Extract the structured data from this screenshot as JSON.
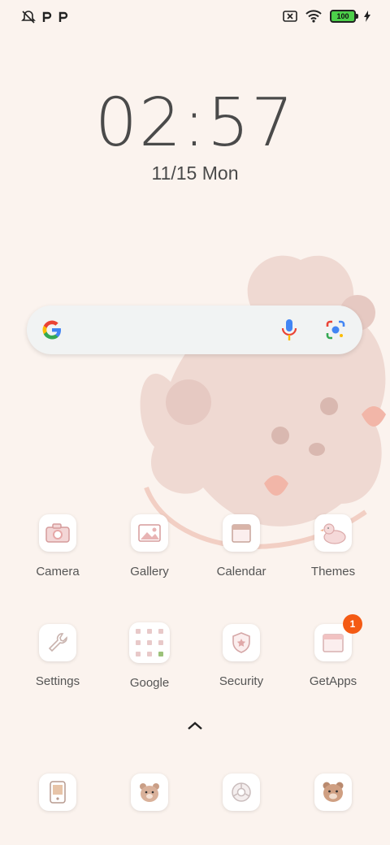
{
  "status_bar": {
    "left_icons": [
      "notification-off-icon",
      "p-icon",
      "p-icon"
    ],
    "right_icons": [
      "sim-off-icon",
      "wifi-icon",
      "battery-icon",
      "charging-icon"
    ],
    "battery_level": "100"
  },
  "clock": {
    "time": "02:57",
    "date_num": "11/15",
    "date_day": "Mon"
  },
  "search": {
    "icons": [
      "google-logo",
      "mic-icon",
      "lens-icon"
    ]
  },
  "apps_row1": [
    {
      "label": "Camera",
      "icon": "camera-icon"
    },
    {
      "label": "Gallery",
      "icon": "gallery-icon"
    },
    {
      "label": "Calendar",
      "icon": "calendar-icon"
    },
    {
      "label": "Themes",
      "icon": "duck-icon"
    }
  ],
  "apps_row2": [
    {
      "label": "Settings",
      "icon": "wrench-icon"
    },
    {
      "label": "Google",
      "icon": "folder-icon"
    },
    {
      "label": "Security",
      "icon": "shield-icon"
    },
    {
      "label": "GetApps",
      "icon": "box-icon",
      "badge": "1"
    }
  ],
  "dock": [
    {
      "icon": "phone-icon"
    },
    {
      "icon": "bear-icon"
    },
    {
      "icon": "browser-icon"
    },
    {
      "icon": "bear-chat-icon"
    }
  ],
  "colors": {
    "background": "#fbf3ee",
    "badge": "#f45a14",
    "battery": "#4cd04a"
  }
}
